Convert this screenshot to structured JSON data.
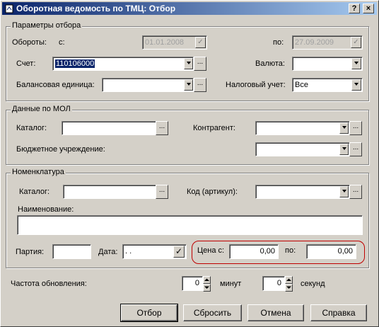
{
  "window": {
    "title": "Оборотная ведомость по ТМЦ: Отбор",
    "help_button": "?",
    "close_button": "×"
  },
  "params": {
    "group_title": "Параметры отбора",
    "turnover_label": "Обороты:",
    "from_label": "с:",
    "date_from": "01.01.2008",
    "to_label": "по:",
    "date_to": "27.09.2009",
    "account_label": "Счет:",
    "account_value": "110106000",
    "currency_label": "Валюта:",
    "currency_value": "",
    "balance_unit_label": "Балансовая единица:",
    "balance_unit_value": "",
    "tax_label": "Налоговый учет:",
    "tax_value": "Все"
  },
  "mol": {
    "group_title": "Данные по МОЛ",
    "catalog_label": "Каталог:",
    "catalog_value": "",
    "contractor_label": "Контрагент:",
    "contractor_value": "",
    "budget_label": "Бюджетное учреждение:",
    "budget_value": ""
  },
  "nomenclature": {
    "group_title": "Номенклатура",
    "catalog_label": "Каталог:",
    "catalog_value": "",
    "code_label": "Код (артикул):",
    "code_value": "",
    "name_label": "Наименование:",
    "name_value": "",
    "batch_label": "Партия:",
    "batch_value": "",
    "date_label": "Дата:",
    "date_value": " .  .",
    "price_from_label": "Цена с:",
    "price_from": "0,00",
    "price_to_label": "по:",
    "price_to": "0,00"
  },
  "refresh": {
    "label": "Частота обновления:",
    "minutes_value": "0",
    "minutes_label": "минут",
    "seconds_value": "0",
    "seconds_label": "секунд"
  },
  "buttons": {
    "ok": "Отбор",
    "reset": "Сбросить",
    "cancel": "Отмена",
    "help": "Справка"
  },
  "browse_label": "...",
  "colors": {
    "title_start": "#0a246a",
    "title_end": "#a6caf0",
    "highlight": "#c00000",
    "face": "#d4d0c8"
  }
}
